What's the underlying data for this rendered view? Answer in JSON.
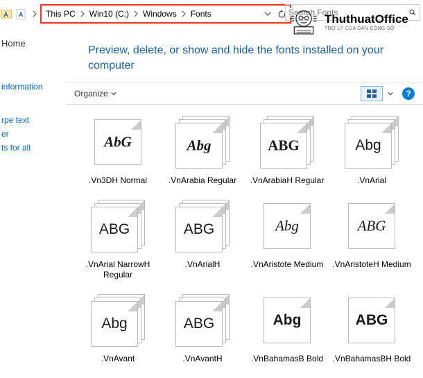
{
  "breadcrumb": [
    "This PC",
    "Win10 (C:)",
    "Windows",
    "Fonts"
  ],
  "search": {
    "placeholder": "Search Fonts"
  },
  "logo": {
    "line1": "ThuthuatOffice",
    "line2": "TRỢ LÝ CỦA DÂN CÔNG SỞ"
  },
  "sidebar": {
    "home": "Home",
    "items": [
      "information",
      "rpe text",
      "er",
      "ts for all"
    ]
  },
  "description": "Preview, delete, or show and hide the fonts installed on your computer",
  "toolbar": {
    "organize": "Organize"
  },
  "fonts": [
    {
      "sample": "AbG",
      "style": "font-family:Georgia,serif;font-style:italic;font-weight:bold;",
      "label": ".Vn3DH Normal",
      "stack": false
    },
    {
      "sample": "Abg",
      "style": "font-family:'Brush Script MT','Lucida Handwriting',cursive;font-style:italic;font-weight:bold;",
      "label": ".VnArabia Regular",
      "stack": true
    },
    {
      "sample": "ABG",
      "style": "font-family:'Segoe Script',cursive;font-weight:bold;",
      "label": ".VnArabiaH Regular",
      "stack": true
    },
    {
      "sample": "Abg",
      "style": "font-family:Arial,sans-serif;",
      "label": ".VnArial",
      "stack": true
    },
    {
      "sample": "ABG",
      "style": "font-family:'Arial Narrow',Arial,sans-serif;font-stretch:condensed;",
      "label": ".VnArial NarrowH Regular",
      "stack": true
    },
    {
      "sample": "ABG",
      "style": "font-family:Arial,sans-serif;",
      "label": ".VnArialH",
      "stack": true
    },
    {
      "sample": "Abg",
      "style": "font-family:'Brush Script MT',cursive;font-style:italic;",
      "label": ".VnAristote Medium",
      "stack": false
    },
    {
      "sample": "ABG",
      "style": "font-family:'Brush Script MT',cursive;font-style:italic;",
      "label": ".VnAristoteH Medium",
      "stack": false
    },
    {
      "sample": "Abg",
      "style": "font-family:'Century Gothic',Futura,sans-serif;",
      "label": ".VnAvant",
      "stack": true
    },
    {
      "sample": "ABG",
      "style": "font-family:'Century Gothic',Futura,sans-serif;",
      "label": ".VnAvantH",
      "stack": true
    },
    {
      "sample": "Abg",
      "style": "font-family:Impact,'Arial Black',sans-serif;font-weight:bold;",
      "label": ".VnBahamasB Bold",
      "stack": false
    },
    {
      "sample": "ABG",
      "style": "font-family:Impact,'Arial Black',sans-serif;font-weight:bold;",
      "label": ".VnBahamasBH Bold",
      "stack": false
    }
  ]
}
